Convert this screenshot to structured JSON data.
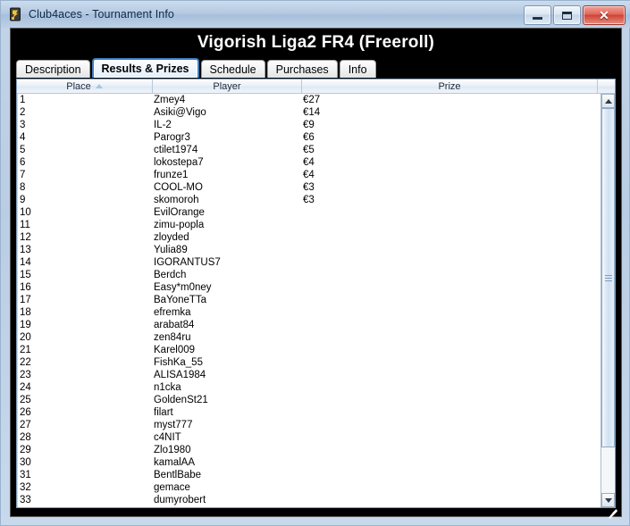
{
  "window": {
    "title": "Club4aces - Tournament Info",
    "icon": "playing-card-icon",
    "caption_buttons": {
      "minimize": "minimize-icon",
      "maximize": "maximize-icon",
      "close": "✕"
    },
    "frame_color": "#b9cde4",
    "titlebar_color": "#b3c8e0",
    "close_color": "#ce4334"
  },
  "banner": {
    "title": "Vigorish Liga2 FR4 (Freeroll)",
    "background": "#000000",
    "text_color": "#ffffff"
  },
  "tabs": [
    {
      "label": "Description",
      "selected": false
    },
    {
      "label": "Results & Prizes",
      "selected": true
    },
    {
      "label": "Schedule",
      "selected": false
    },
    {
      "label": "Purchases",
      "selected": false
    },
    {
      "label": "Info",
      "selected": false
    }
  ],
  "selected_tab_border": "#3c7fc0",
  "table": {
    "columns": [
      {
        "key": "place",
        "label": "Place",
        "sorted": "ascending",
        "sort_icon": "sort-ascending-icon"
      },
      {
        "key": "player",
        "label": "Player",
        "sorted": null,
        "sort_icon": null
      },
      {
        "key": "prize",
        "label": "Prize",
        "sorted": null,
        "sort_icon": null
      }
    ],
    "rows": [
      {
        "place": "1",
        "player": "Zmey4",
        "prize": "€27"
      },
      {
        "place": "2",
        "player": "Asiki@Vigo",
        "prize": "€14"
      },
      {
        "place": "3",
        "player": "IL-2",
        "prize": "€9"
      },
      {
        "place": "4",
        "player": "Parogr3",
        "prize": "€6"
      },
      {
        "place": "5",
        "player": "ctilet1974",
        "prize": "€5"
      },
      {
        "place": "6",
        "player": "lokostepa7",
        "prize": "€4"
      },
      {
        "place": "7",
        "player": "frunze1",
        "prize": "€4"
      },
      {
        "place": "8",
        "player": "COOL-MO",
        "prize": "€3"
      },
      {
        "place": "9",
        "player": "skomoroh",
        "prize": "€3"
      },
      {
        "place": "10",
        "player": "EvilOrange",
        "prize": ""
      },
      {
        "place": "11",
        "player": "zimu-popla",
        "prize": ""
      },
      {
        "place": "12",
        "player": "zloyded",
        "prize": ""
      },
      {
        "place": "13",
        "player": "Yulia89",
        "prize": ""
      },
      {
        "place": "14",
        "player": "IGORANTUS7",
        "prize": ""
      },
      {
        "place": "15",
        "player": "Berdch",
        "prize": ""
      },
      {
        "place": "16",
        "player": "Easy*m0ney",
        "prize": ""
      },
      {
        "place": "17",
        "player": "BaYoneTTa",
        "prize": ""
      },
      {
        "place": "18",
        "player": "efremka",
        "prize": ""
      },
      {
        "place": "19",
        "player": "arabat84",
        "prize": ""
      },
      {
        "place": "20",
        "player": "zen84ru",
        "prize": ""
      },
      {
        "place": "21",
        "player": "Karel009",
        "prize": ""
      },
      {
        "place": "22",
        "player": "FishKa_55",
        "prize": ""
      },
      {
        "place": "23",
        "player": "ALISA1984",
        "prize": ""
      },
      {
        "place": "24",
        "player": "n1cka",
        "prize": ""
      },
      {
        "place": "25",
        "player": "GoldenSt21",
        "prize": ""
      },
      {
        "place": "26",
        "player": "filart",
        "prize": ""
      },
      {
        "place": "27",
        "player": "myst777",
        "prize": ""
      },
      {
        "place": "28",
        "player": "c4NIT",
        "prize": ""
      },
      {
        "place": "29",
        "player": "Zlo1980",
        "prize": ""
      },
      {
        "place": "30",
        "player": "kamalAA",
        "prize": ""
      },
      {
        "place": "31",
        "player": "BentlBabe",
        "prize": ""
      },
      {
        "place": "32",
        "player": "gemace",
        "prize": ""
      },
      {
        "place": "33",
        "player": "dumyrobert",
        "prize": ""
      }
    ]
  },
  "scrollbar": {
    "up_icon": "scroll-up-arrow-icon",
    "down_icon": "scroll-down-arrow-icon",
    "thumb_icon": "scrollbar-thumb",
    "grip_icon": "resize-grip-icon"
  }
}
